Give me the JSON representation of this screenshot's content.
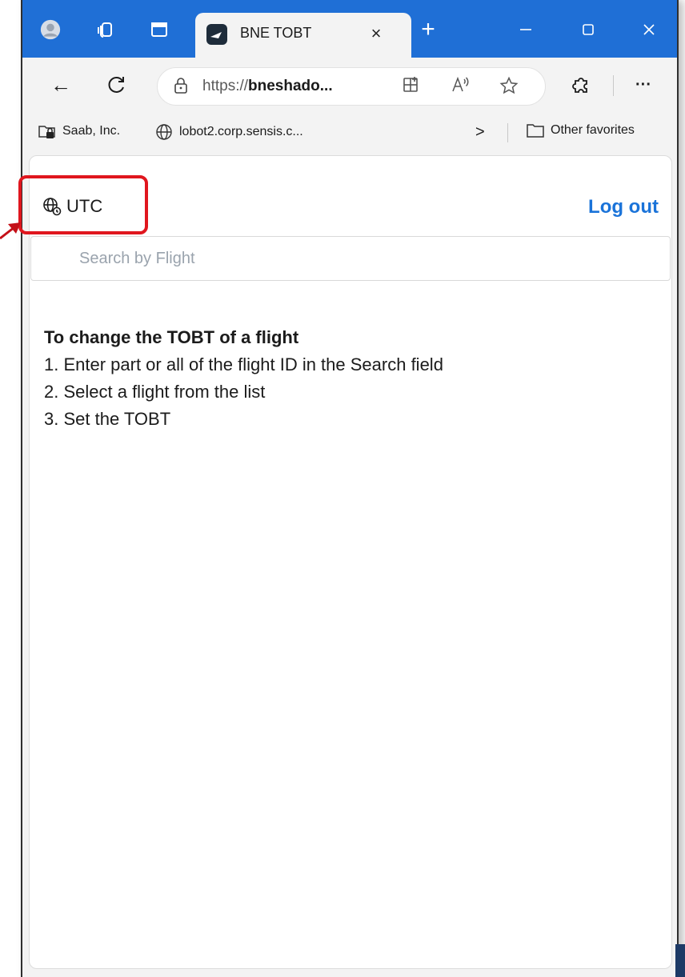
{
  "tab": {
    "title": "BNE TOBT",
    "close": "×"
  },
  "window": {
    "new_tab": "+",
    "minimize": "—",
    "maximize": "☐",
    "close": "✕"
  },
  "toolbar": {
    "back": "←",
    "refresh": "C",
    "url_prefix": "https://",
    "url_host": "bneshado...",
    "menu": "···"
  },
  "favorites": {
    "items": [
      {
        "label": "Saab, Inc."
      },
      {
        "label": "lobot2.corp.sensis.c..."
      }
    ],
    "overflow": ">",
    "other": "Other favorites"
  },
  "page": {
    "timezone": "UTC",
    "logout": "Log out",
    "search_placeholder": "Search by Flight",
    "instructions": {
      "heading": "To change the TOBT of a flight",
      "steps": [
        "1. Enter part or all of the flight ID in the Search field",
        "2. Select a flight from the list",
        "3. Set the TOBT"
      ]
    }
  },
  "colors": {
    "titlebar": "#1f6fd6",
    "link": "#1a73d9",
    "highlight": "#e0161e"
  }
}
